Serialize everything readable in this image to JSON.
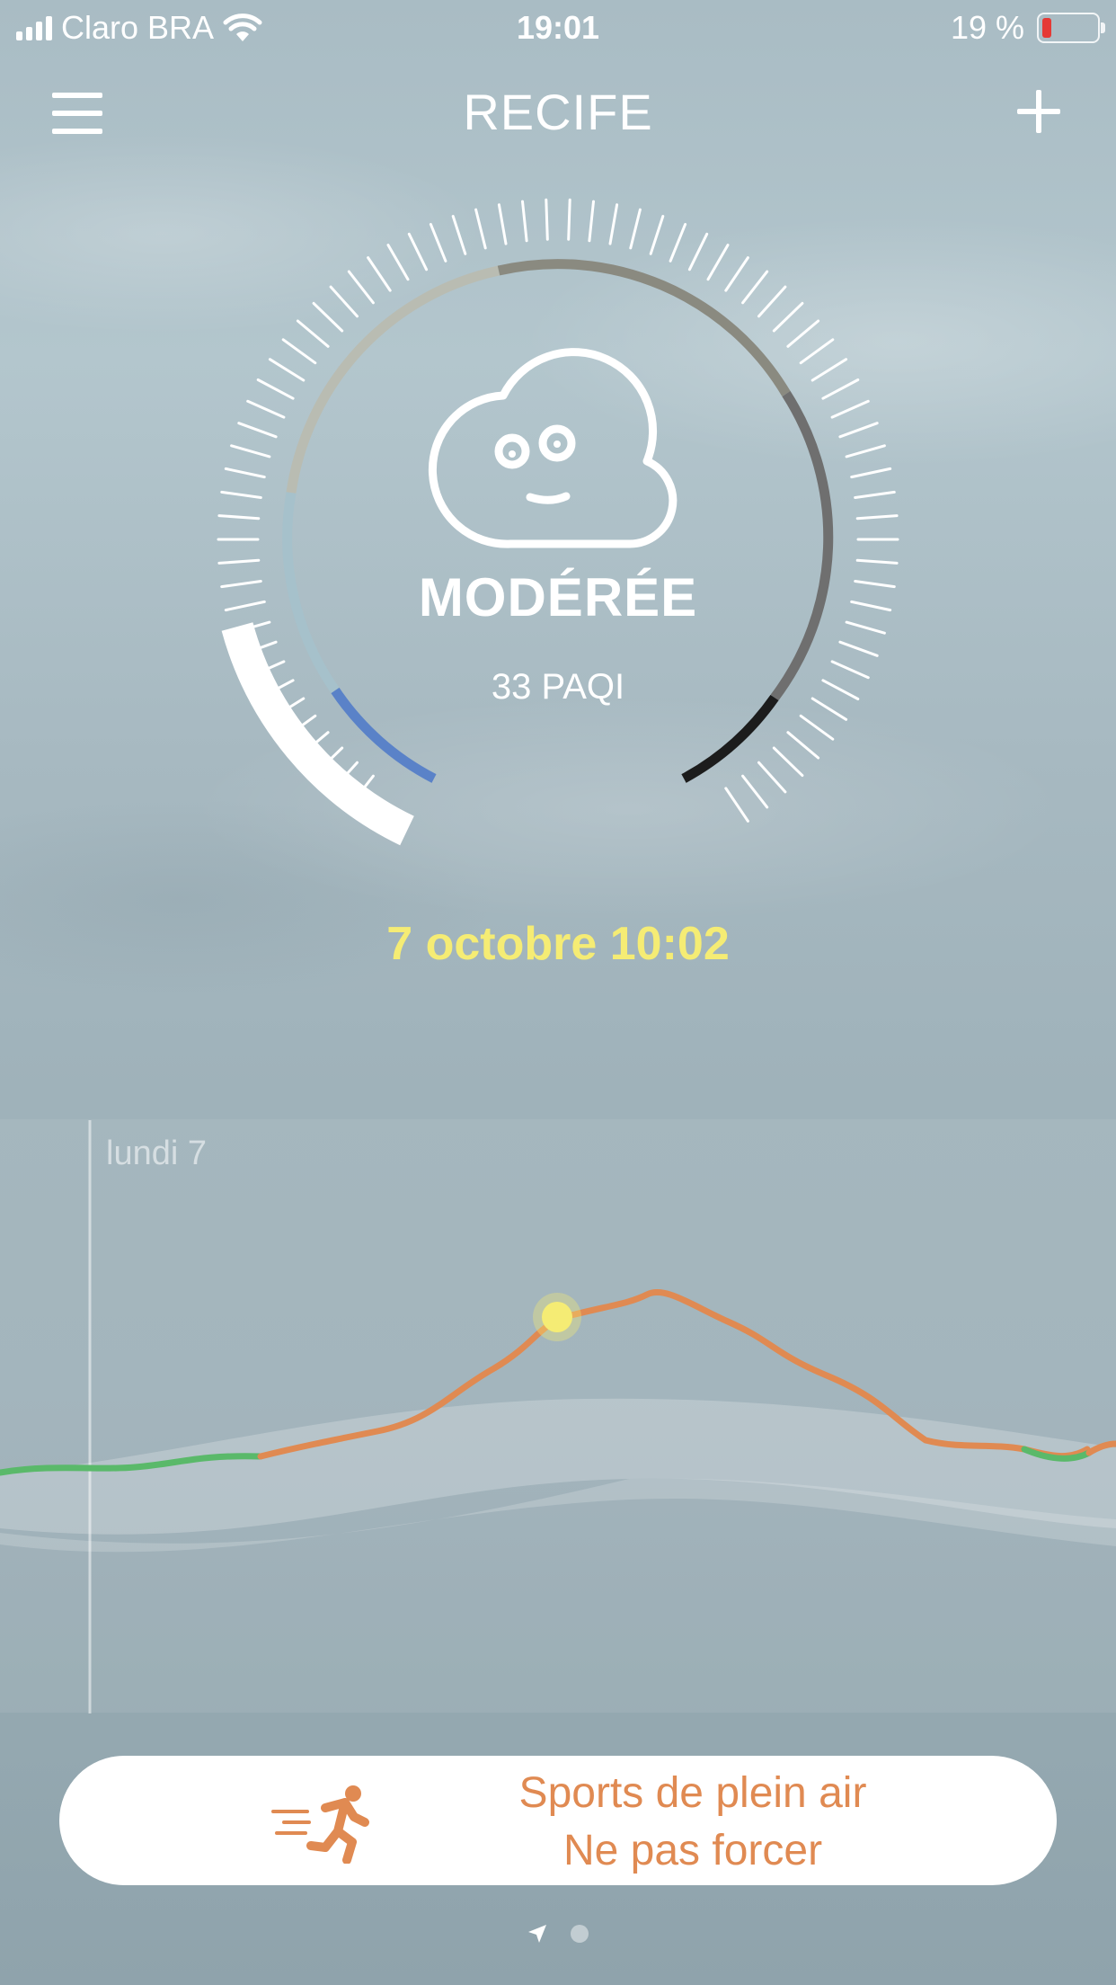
{
  "status_bar": {
    "carrier": "Claro BRA",
    "time": "19:01",
    "battery": "19 %"
  },
  "header": {
    "city": "RECIFE"
  },
  "gauge": {
    "level_label": "MODÉRÉE",
    "value": "33 PAQI",
    "face_icon": "cloud-face-icon"
  },
  "reading_time": "7 octobre 10:02",
  "forecast_chart": {
    "day_label": "lundi 7"
  },
  "advice": {
    "line1": "Sports de plein air",
    "line2": "Ne pas forcer",
    "icon": "runner-icon"
  },
  "colors": {
    "accent_yellow": "#f5ec74",
    "advice_orange": "#e08a52",
    "line_green": "#5ab96a"
  },
  "pager": {
    "pages": 2,
    "current": 0
  }
}
